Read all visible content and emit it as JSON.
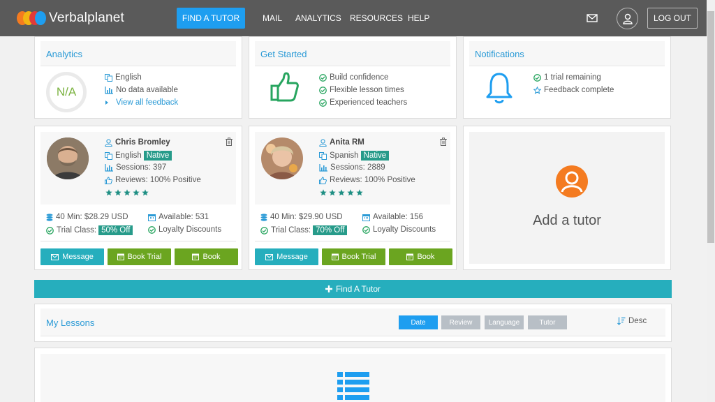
{
  "brand": {
    "name": "Verbalplanet",
    "colors": [
      "#f47b20",
      "#f2b413",
      "#e03a3a",
      "#1e9ef0"
    ]
  },
  "nav": {
    "find_tutor": "FIND A TUTOR",
    "items": [
      "MAIL",
      "ANALYTICS",
      "RESOURCES",
      "HELP"
    ],
    "logout": "LOG OUT"
  },
  "analytics": {
    "title": "Analytics",
    "score": "N/A",
    "language": "English",
    "data_status": "No data available",
    "feedback_link": "View all feedback"
  },
  "get_started": {
    "title": "Get Started",
    "items": [
      "Build confidence",
      "Flexible lesson times",
      "Experienced teachers"
    ]
  },
  "notifications": {
    "title": "Notifications",
    "items": [
      "1 trial remaining",
      "Feedback complete"
    ]
  },
  "tutors": [
    {
      "name": "Chris Bromley",
      "language": "English",
      "native_label": "Native",
      "sessions": "Sessions: 397",
      "reviews": "Reviews: 100% Positive",
      "rating": 5,
      "price": "40 Min: $28.29 USD",
      "available": "Available: 531",
      "trial_label": "Trial Class:",
      "trial_discount": "50% Off",
      "loyalty": "Loyalty Discounts",
      "btn_message": "Message",
      "btn_book_trial": "Book Trial",
      "btn_book": "Book"
    },
    {
      "name": "Anita RM",
      "language": "Spanish",
      "native_label": "Native",
      "sessions": "Sessions: 2889",
      "reviews": "Reviews: 100% Positive",
      "rating": 5,
      "price": "40 Min: $29.90 USD",
      "available": "Available: 156",
      "trial_label": "Trial Class:",
      "trial_discount": "70% Off",
      "loyalty": "Loyalty Discounts",
      "btn_message": "Message",
      "btn_book_trial": "Book Trial",
      "btn_book": "Book"
    }
  ],
  "add_tutor": {
    "label": "Add a tutor"
  },
  "find_bar": {
    "label": "Find A Tutor"
  },
  "lessons": {
    "title": "My Lessons",
    "sort_buttons": [
      "Date",
      "Review",
      "Language",
      "Tutor"
    ],
    "order": "Desc"
  }
}
